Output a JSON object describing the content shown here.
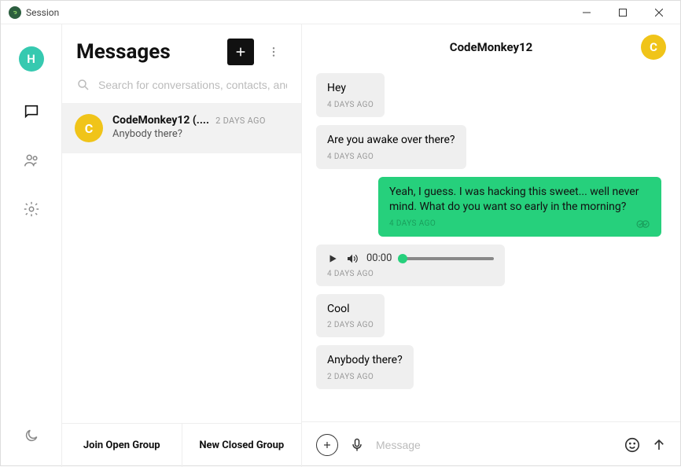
{
  "window": {
    "title": "Session"
  },
  "nav": {
    "avatar_letter": "H"
  },
  "left": {
    "title": "Messages",
    "search_placeholder": "Search for conversations, contacts, and ...",
    "conversation": {
      "avatar_letter": "C",
      "name": "CodeMonkey12 (....",
      "time": "2 DAYS AGO",
      "snippet": "Anybody there?"
    },
    "footer": {
      "open": "Join Open Group",
      "closed": "New Closed Group"
    }
  },
  "chat": {
    "title": "CodeMonkey12",
    "avatar_letter": "C",
    "messages": [
      {
        "dir": "in",
        "text": "Hey",
        "time": "4 DAYS AGO"
      },
      {
        "dir": "in",
        "text": "Are you awake over there?",
        "time": "4 DAYS AGO"
      },
      {
        "dir": "out",
        "text": "Yeah, I guess. I was hacking this sweet... well never mind. What do you want so early in the morning?",
        "time": "4 DAYS AGO"
      },
      {
        "dir": "in",
        "type": "audio",
        "duration": "00:00",
        "time": "4 DAYS AGO"
      },
      {
        "dir": "in",
        "text": "Cool",
        "time": "2 DAYS AGO"
      },
      {
        "dir": "in",
        "text": "Anybody there?",
        "time": "2 DAYS AGO"
      }
    ],
    "composer_placeholder": "Message"
  }
}
